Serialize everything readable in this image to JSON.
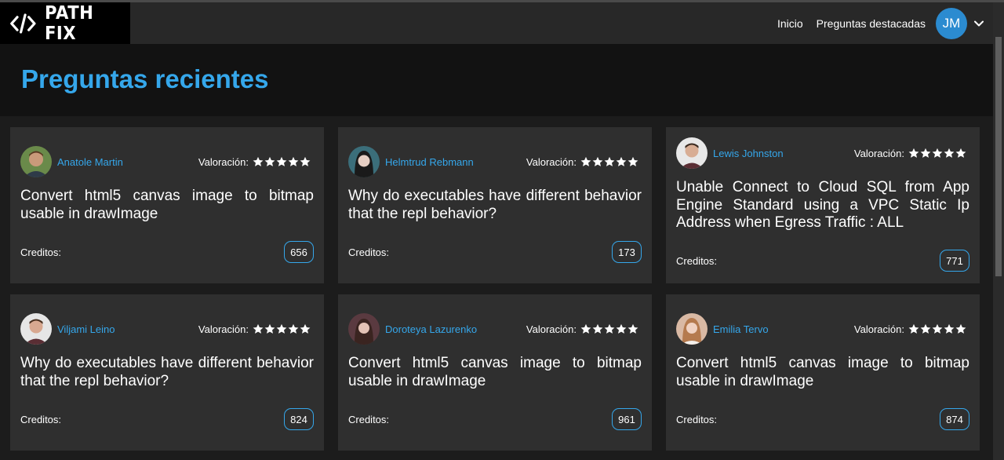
{
  "brand": {
    "name": "PATH FIX"
  },
  "nav": {
    "links": [
      "Inicio",
      "Preguntas destacadas"
    ],
    "user_initials": "JM"
  },
  "hero": {
    "title": "Preguntas recientes"
  },
  "labels": {
    "rating": "Valoración:",
    "credits": "Creditos:"
  },
  "cards": [
    {
      "author": "Anatole Martin",
      "rating": 5,
      "question": "Convert html5 canvas image to bitmap usable in drawImage",
      "credits": "656",
      "avatar_color": "#6a8a4a"
    },
    {
      "author": "Helmtrud Rebmann",
      "rating": 5,
      "question": "Why do executables have different behavior that the repl behavior?",
      "credits": "173",
      "avatar_color": "#3b6e7a"
    },
    {
      "author": "Lewis Johnston",
      "rating": 5,
      "question": "Unable Connect to Cloud SQL from App Engine Standard using a VPC Static Ip Address when Egress Traffic : ALL",
      "credits": "771",
      "avatar_color": "#e8e8e8"
    },
    {
      "author": "Viljami Leino",
      "rating": 5,
      "question": "Why do executables have different behavior that the repl behavior?",
      "credits": "824",
      "avatar_color": "#e6e6e6"
    },
    {
      "author": "Doroteya Lazurenko",
      "rating": 5,
      "question": "Convert html5 canvas image to bitmap usable in drawImage",
      "credits": "961",
      "avatar_color": "#5a3a40"
    },
    {
      "author": "Emilia Tervo",
      "rating": 5,
      "question": "Convert html5 canvas image to bitmap usable in drawImage",
      "credits": "874",
      "avatar_color": "#d9b9a4"
    }
  ],
  "colors": {
    "accent": "#35a7eb",
    "card_bg": "#2f2f2f",
    "hero_bg": "#121212",
    "nav_bg": "#282828"
  }
}
